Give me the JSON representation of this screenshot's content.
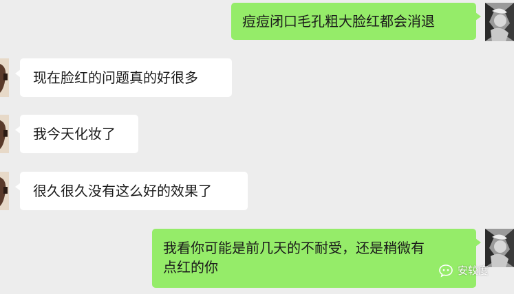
{
  "chat": {
    "messages": [
      {
        "sender": "self",
        "text": "痘痘闭口毛孔粗大脸红都会消退"
      },
      {
        "sender": "other",
        "text": "现在脸红的问题真的好很多"
      },
      {
        "sender": "other",
        "text": "我今天化妆了"
      },
      {
        "sender": "other",
        "text": "很久很久没有这么好的效果了"
      },
      {
        "sender": "self",
        "text": "我看你可能是前几天的不耐受，还是稍微有\n点红的你"
      }
    ]
  },
  "watermark": {
    "text": "安较度",
    "icon": "wechat-official-account-icon"
  },
  "colors": {
    "background": "#ededed",
    "self_bubble": "#95ec69",
    "other_bubble": "#ffffff"
  }
}
